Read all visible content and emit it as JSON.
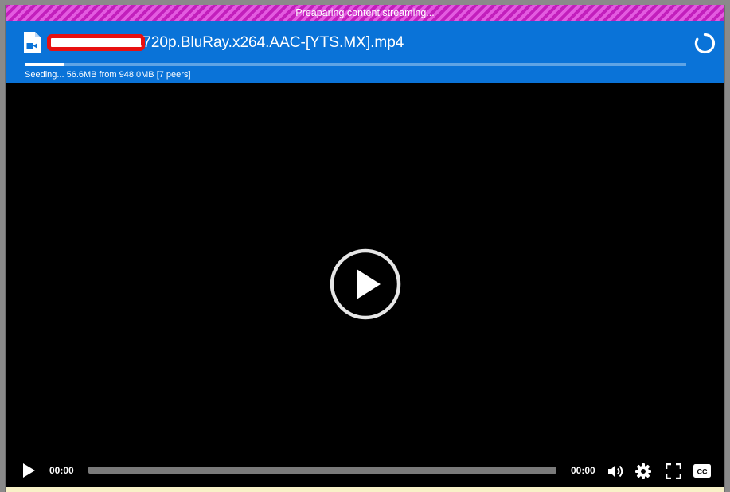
{
  "banner": {
    "text": "Preaparing content streaming..."
  },
  "header": {
    "file_icon": "video-file-icon",
    "title_visible": ".720p.BluRay.x264.AAC-[YTS.MX].mp4",
    "title_redacted": true,
    "loading_icon": "loading-spinner-icon",
    "progress_fraction": 0.06,
    "status": "Seeding... 56.6MB from 948.0MB [7 peers]"
  },
  "player": {
    "big_play_icon": "play-circle-icon",
    "play_icon": "play-icon",
    "current_time": "00:00",
    "duration": "00:00",
    "seek_fraction": 0,
    "volume_icon": "volume-icon",
    "settings_icon": "gear-icon",
    "fullscreen_icon": "fullscreen-icon",
    "captions_icon": "closed-captions-icon",
    "captions_label": "CC"
  },
  "colors": {
    "banner": "#c21fbc",
    "header": "#0a73d8",
    "redaction": "#e81010",
    "video_bg": "#000000",
    "bottom_strip": "#f8f1c7"
  }
}
